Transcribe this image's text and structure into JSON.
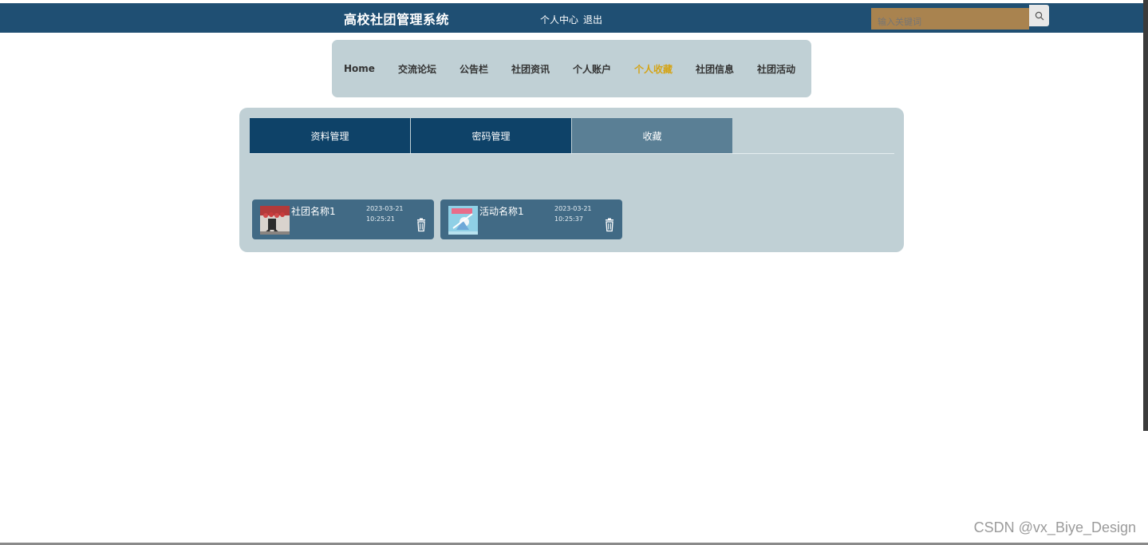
{
  "header": {
    "title": "高校社团管理系统",
    "links": [
      "个人中心",
      "退出"
    ],
    "search": {
      "placeholder": "输入关键词"
    }
  },
  "nav": {
    "items": [
      "Home",
      "交流论坛",
      "公告栏",
      "社团资讯",
      "个人账户",
      "个人收藏",
      "社团信息",
      "社团活动"
    ],
    "active": "个人收藏"
  },
  "tabs": {
    "items": [
      "资料管理",
      "密码管理",
      "收藏"
    ],
    "active": "收藏"
  },
  "favorites": [
    {
      "name": "社团名称1",
      "date": "2023-03-21",
      "time": "10:25:21"
    },
    {
      "name": "活动名称1",
      "date": "2023-03-21",
      "time": "10:25:37"
    }
  ],
  "watermark": "CSDN @vx_Biye_Design",
  "colors": {
    "topbar": "#1f4f73",
    "active_nav": "#d4a417",
    "panel": "#c0d0d5",
    "tab": "#0e4268",
    "tab_active": "#5a7f95",
    "card": "#416a85"
  }
}
